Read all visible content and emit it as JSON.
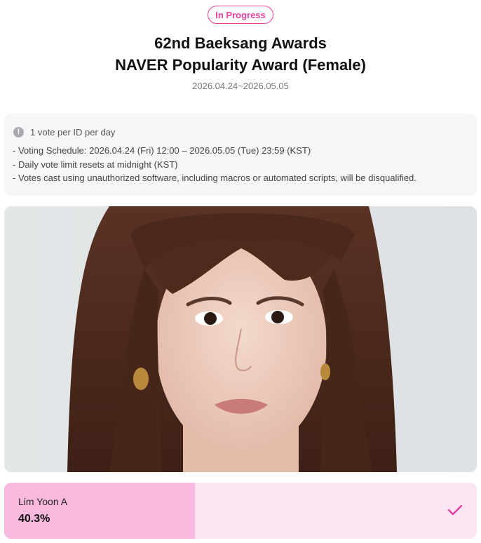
{
  "status": {
    "label": "In Progress"
  },
  "award": {
    "title_line1": "62nd Baeksang Awards",
    "title_line2": "NAVER Popularity Award (Female)",
    "date_range": "2026.04.24~2026.05.05"
  },
  "notice": {
    "icon": "info-icon",
    "headline": "1 vote per ID per day",
    "items": [
      "- Voting Schedule: 2026.04.24 (Fri) 12:00 – 2026.05.05 (Tue) 23:59 (KST)",
      "- Daily vote limit resets at midnight (KST)",
      "- Votes cast using unauthorized software, including macros or automated scripts, will be disqualified."
    ]
  },
  "candidate": {
    "name": "Lim Yoon A",
    "percent_label": "40.3%",
    "percent_value": 40.3,
    "selected": true,
    "check_icon": "check-icon"
  },
  "colors": {
    "accent": "#e63fa0",
    "bar_fill": "#f9b9df",
    "bar_track": "#fde6f3"
  }
}
